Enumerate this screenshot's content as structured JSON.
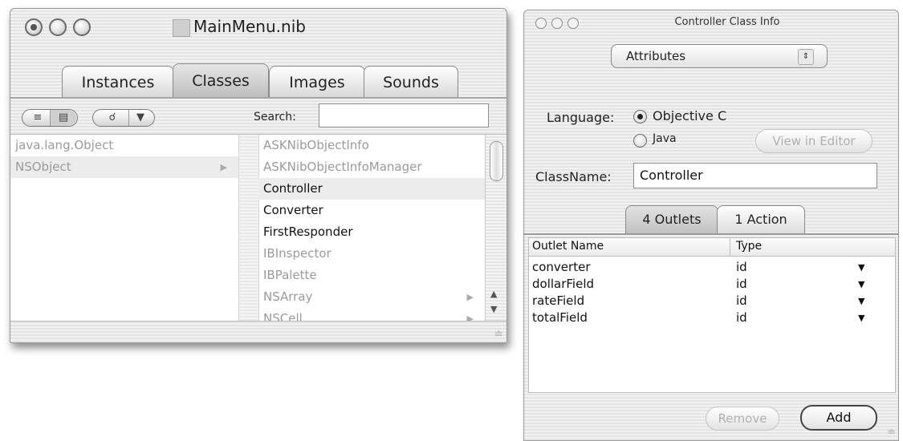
{
  "main_window": {
    "title": "MainMenu.nib",
    "tabs": [
      {
        "label": "Instances",
        "active": false
      },
      {
        "label": "Classes",
        "active": true
      },
      {
        "label": "Images",
        "active": false
      },
      {
        "label": "Sounds",
        "active": false
      }
    ],
    "toolbar": {
      "view_icons": [
        "list-view-icon",
        "column-view-icon"
      ],
      "search_menu_icon": "magnifier-icon",
      "search_label": "Search:",
      "search_value": ""
    },
    "browser": {
      "column1": [
        {
          "name": "java.lang.Object",
          "dim": true,
          "has_children": false
        },
        {
          "name": "NSObject",
          "dim": true,
          "has_children": true,
          "selected": true
        }
      ],
      "column2": [
        {
          "name": "ASKNibObjectInfo",
          "dim": true,
          "has_children": false
        },
        {
          "name": "ASKNibObjectInfoManager",
          "dim": true,
          "has_children": false
        },
        {
          "name": "Controller",
          "dim": false,
          "has_children": false,
          "selected": true
        },
        {
          "name": "Converter",
          "dim": false,
          "has_children": false
        },
        {
          "name": "FirstResponder",
          "dim": false,
          "has_children": false
        },
        {
          "name": "IBInspector",
          "dim": true,
          "has_children": false
        },
        {
          "name": "IBPalette",
          "dim": true,
          "has_children": false
        },
        {
          "name": "NSArray",
          "dim": true,
          "has_children": true
        },
        {
          "name": "NSCell",
          "dim": true,
          "has_children": true
        }
      ]
    }
  },
  "inspector": {
    "title": "Controller Class Info",
    "popup_value": "Attributes",
    "language_label": "Language:",
    "language_options": [
      {
        "label": "Objective C",
        "selected": true
      },
      {
        "label": "Java",
        "selected": false
      }
    ],
    "view_in_editor": "View in Editor",
    "classname_label": "ClassName:",
    "classname_value": "Controller",
    "tabs": [
      {
        "label": "4 Outlets",
        "active": true
      },
      {
        "label": "1 Action",
        "active": false
      }
    ],
    "table": {
      "headers": [
        "Outlet Name",
        "Type"
      ],
      "rows": [
        {
          "name": "converter",
          "type": "id"
        },
        {
          "name": "dollarField",
          "type": "id"
        },
        {
          "name": "rateField",
          "type": "id"
        },
        {
          "name": "totalField",
          "type": "id"
        }
      ]
    },
    "buttons": {
      "remove": "Remove",
      "add": "Add"
    }
  }
}
